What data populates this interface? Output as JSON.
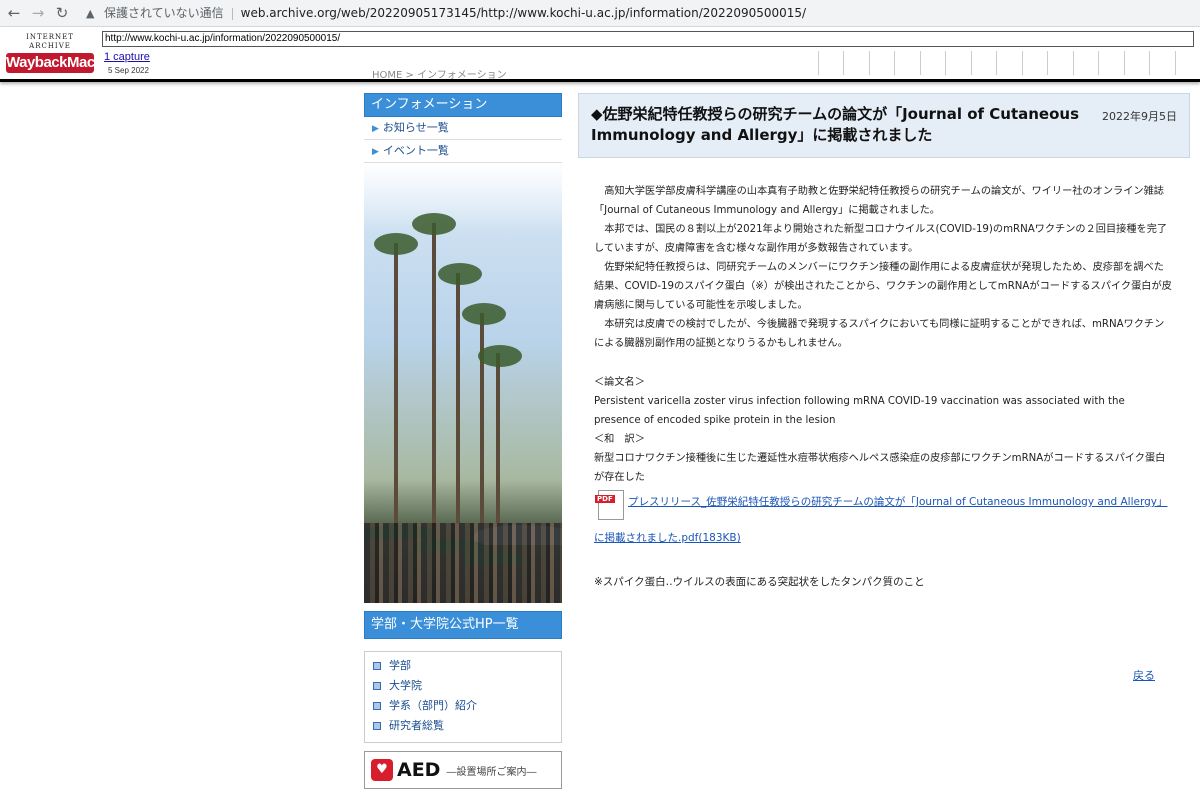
{
  "browser": {
    "back": "←",
    "forward": "→",
    "reload": "↻",
    "warning_icon": "warning-icon",
    "not_secure": "保護されていない通信",
    "url": "web.archive.org/web/20220905173145/http://www.kochi-u.ac.jp/information/2022090500015/"
  },
  "wayback": {
    "logo_top": "INTERNET ARCHIVE",
    "logo_main": "WaybackMachine",
    "url_field": "http://www.kochi-u.ac.jp/information/2022090500015/",
    "captures": "1 capture",
    "capture_date": "5 Sep 2022"
  },
  "breadcrumb": "HOME > インフォメーション",
  "sidebar": {
    "heading": "インフォメーション",
    "links": [
      "お知らせ一覧",
      "イベント一覧"
    ],
    "heading2": "学部・大学院公式HP一覧",
    "box_items": [
      "学部",
      "大学院",
      "学系（部門）紹介",
      "研究者総覧"
    ],
    "aed_main": "AED",
    "aed_sub": "―設置場所ご案内―"
  },
  "main": {
    "title": "◆佐野栄紀特任教授らの研究チームの論文が「Journal of Cutaneous Immunology and Allergy」に掲載されました",
    "date": "2022年9月5日",
    "paragraphs": [
      "高知大学医学部皮膚科学講座の山本真有子助教と佐野栄紀特任教授らの研究チームの論文が、ワイリー社のオンライン雑誌「Journal of Cutaneous Immunology and Allergy」に掲載されました。",
      "本邦では、国民の８割以上が2021年より開始された新型コロナウイルス(COVID-19)のmRNAワクチンの２回目接種を完了していますが、皮膚障害を含む様々な副作用が多数報告されています。",
      "佐野栄紀特任教授らは、同研究チームのメンバーにワクチン接種の副作用による皮膚症状が発現したため、皮疹部を調べた結果、COVID-19のスパイク蛋白（※）が検出されたことから、ワクチンの副作用としてmRNAがコードするスパイク蛋白が皮膚病態に関与している可能性を示唆しました。",
      "本研究は皮膚での検討でしたが、今後臓器で発現するスパイクにおいても同様に証明することができれば、mRNAワクチンによる臓器別副作用の証拠となりうるかもしれません。"
    ],
    "ref_label": "＜論文名＞",
    "ref_title": "Persistent varicella zoster virus infection following mRNA COVID-19 vaccination was associated with the presence of encoded spike protein in the lesion",
    "trans_label": "＜和　訳＞",
    "trans_text": "新型コロナワクチン接種後に生じた遷延性水痘帯状疱疹ヘルペス感染症の皮疹部にワクチンmRNAがコードするスパイク蛋白が存在した",
    "pdf_badge": "PDF",
    "pdf_link_1": "プレスリリース_佐野栄紀特任教授らの研究チームの論文が「Journal of Cutaneous Immunology and Allergy」",
    "pdf_link_2": "に掲載されました.pdf(183KB)",
    "note": "※スパイク蛋白‥ウイルスの表面にある突起状をしたタンパク質のこと",
    "back_link": "戻る"
  }
}
